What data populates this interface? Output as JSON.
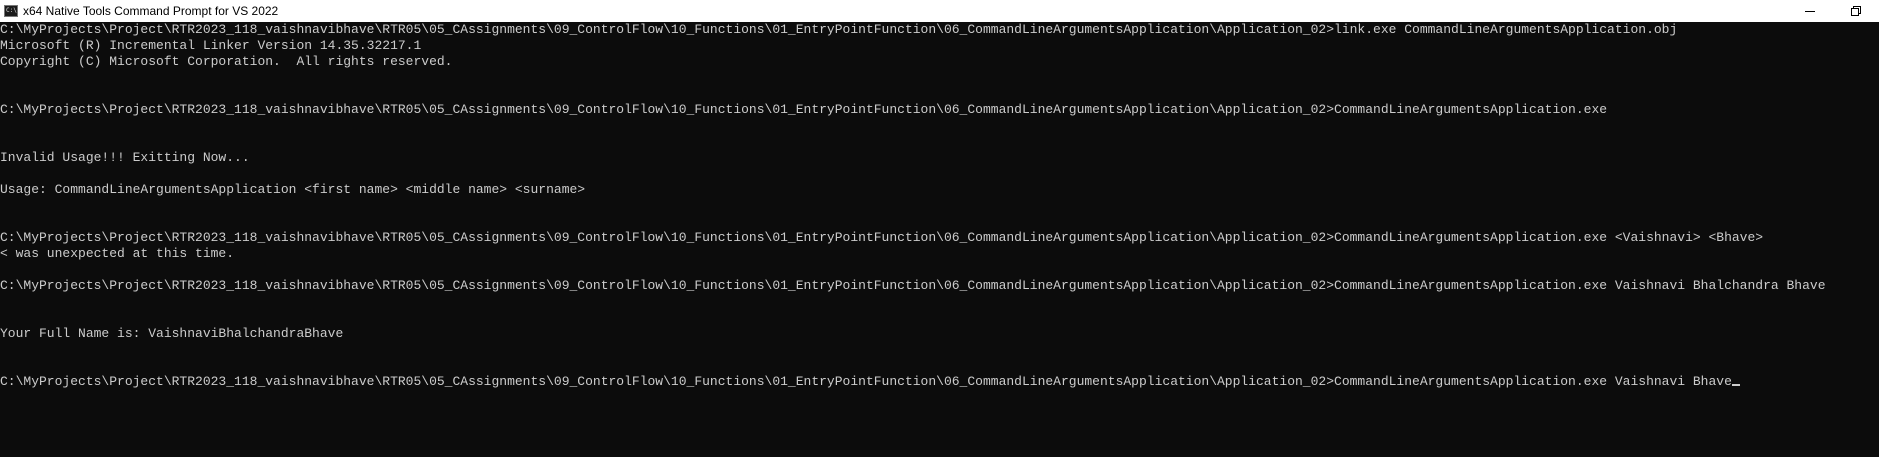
{
  "window": {
    "title": "x64 Native Tools Command Prompt for VS 2022",
    "app_icon_glyph": "C:\\"
  },
  "console": {
    "lines": [
      "C:\\MyProjects\\Project\\RTR2023_118_vaishnavibhave\\RTR05\\05_CAssignments\\09_ControlFlow\\10_Functions\\01_EntryPointFunction\\06_CommandLineArgumentsApplication\\Application_02>link.exe CommandLineArgumentsApplication.obj",
      "Microsoft (R) Incremental Linker Version 14.35.32217.1",
      "Copyright (C) Microsoft Corporation.  All rights reserved.",
      "",
      "",
      "C:\\MyProjects\\Project\\RTR2023_118_vaishnavibhave\\RTR05\\05_CAssignments\\09_ControlFlow\\10_Functions\\01_EntryPointFunction\\06_CommandLineArgumentsApplication\\Application_02>CommandLineArgumentsApplication.exe",
      "",
      "",
      "Invalid Usage!!! Exitting Now...",
      "",
      "Usage: CommandLineArgumentsApplication <first name> <middle name> <surname>",
      "",
      "",
      "C:\\MyProjects\\Project\\RTR2023_118_vaishnavibhave\\RTR05\\05_CAssignments\\09_ControlFlow\\10_Functions\\01_EntryPointFunction\\06_CommandLineArgumentsApplication\\Application_02>CommandLineArgumentsApplication.exe <Vaishnavi> <Bhave>",
      "< was unexpected at this time.",
      "",
      "C:\\MyProjects\\Project\\RTR2023_118_vaishnavibhave\\RTR05\\05_CAssignments\\09_ControlFlow\\10_Functions\\01_EntryPointFunction\\06_CommandLineArgumentsApplication\\Application_02>CommandLineArgumentsApplication.exe Vaishnavi Bhalchandra Bhave",
      "",
      "",
      "Your Full Name is: VaishnaviBhalchandraBhave",
      "",
      "",
      "C:\\MyProjects\\Project\\RTR2023_118_vaishnavibhave\\RTR05\\05_CAssignments\\09_ControlFlow\\10_Functions\\01_EntryPointFunction\\06_CommandLineArgumentsApplication\\Application_02>CommandLineArgumentsApplication.exe Vaishnavi Bhave"
    ],
    "cursor_line_index": 22
  },
  "colors": {
    "background": "#0c0c0c",
    "text": "#cccccc",
    "titlebar": "#ffffff"
  }
}
